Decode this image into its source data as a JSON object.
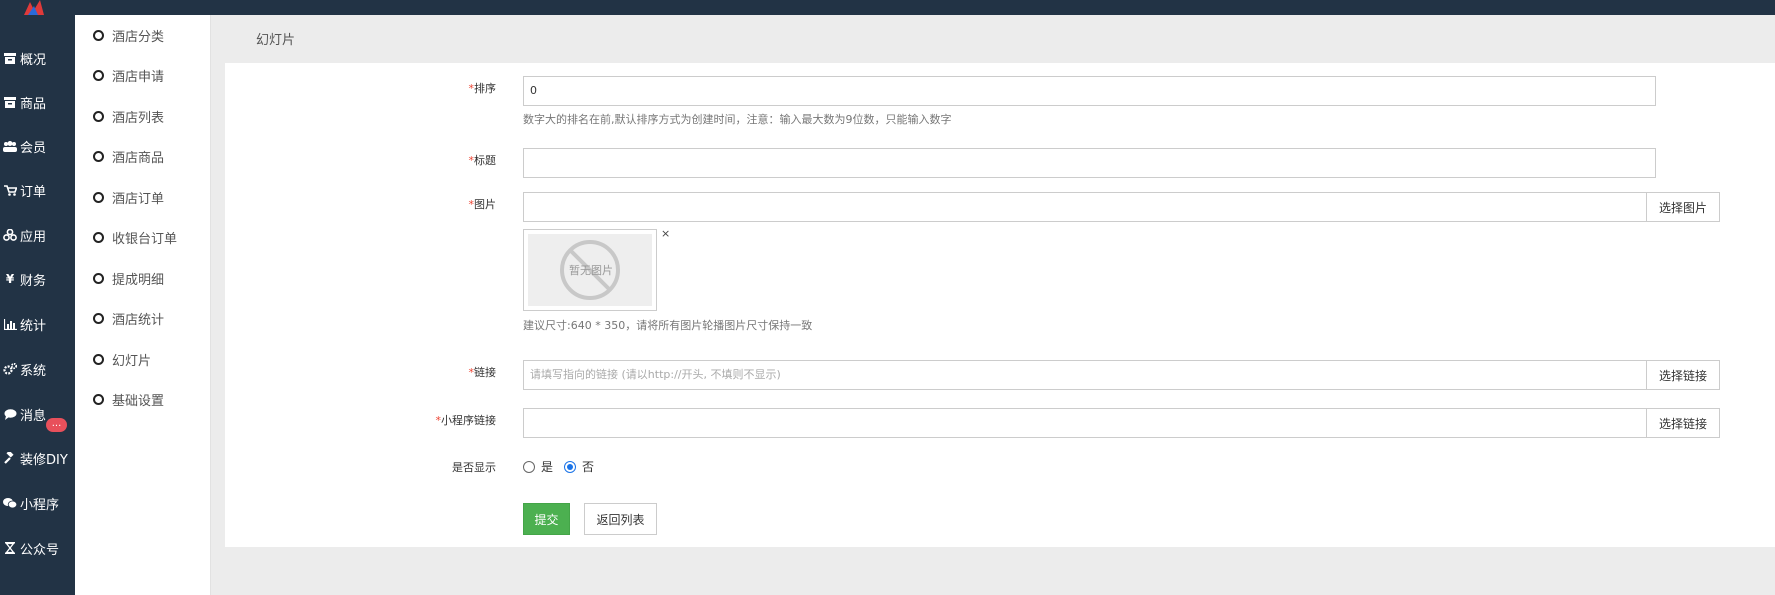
{
  "sidebar": {
    "items": [
      {
        "label": "概况",
        "icon": "archive-icon"
      },
      {
        "label": "商品",
        "icon": "box-icon"
      },
      {
        "label": "会员",
        "icon": "users-icon"
      },
      {
        "label": "订单",
        "icon": "cart-icon"
      },
      {
        "label": "应用",
        "icon": "apps-icon"
      },
      {
        "label": "财务",
        "icon": "yen-icon"
      },
      {
        "label": "统计",
        "icon": "bar-chart-icon"
      },
      {
        "label": "系统",
        "icon": "gears-icon"
      },
      {
        "label": "消息",
        "icon": "chat-icon"
      },
      {
        "label": "装修DIY",
        "icon": "gavel-icon"
      },
      {
        "label": "小程序",
        "icon": "wechat-icon"
      },
      {
        "label": "公众号",
        "icon": "hourglass-icon"
      }
    ],
    "message_badge": "..."
  },
  "subnav": {
    "items": [
      "酒店分类",
      "酒店申请",
      "酒店列表",
      "酒店商品",
      "酒店订单",
      "收银台订单",
      "提成明细",
      "酒店统计",
      "幻灯片",
      "基础设置"
    ]
  },
  "page": {
    "title": "幻灯片"
  },
  "form": {
    "sort": {
      "required": "*",
      "label": "排序",
      "value": "0",
      "help": "数字大的排名在前,默认排序方式为创建时间，注意：输入最大数为9位数，只能输入数字"
    },
    "title": {
      "required": "*",
      "label": "标题",
      "value": ""
    },
    "image": {
      "required": "*",
      "label": "图片",
      "value": "",
      "button": "选择图片",
      "placeholder_image_text": "暂无图片",
      "close": "×",
      "help": "建议尺寸:640 * 350，请将所有图片轮播图片尺寸保持一致"
    },
    "link": {
      "required": "*",
      "label": "链接",
      "placeholder": "请填写指向的链接 (请以http://开头, 不填则不显示)",
      "button": "选择链接"
    },
    "mini_link": {
      "required": "*",
      "label": "小程序链接",
      "value": "",
      "button": "选择链接"
    },
    "show": {
      "label": "是否显示",
      "options": [
        "是",
        "否"
      ],
      "selected": "否"
    },
    "submit": "提交",
    "back": "返回列表"
  },
  "colors": {
    "sidebar_bg": "#223345",
    "submit_green": "#4cb050",
    "required_red": "#e43",
    "badge_red": "#e8505b"
  }
}
